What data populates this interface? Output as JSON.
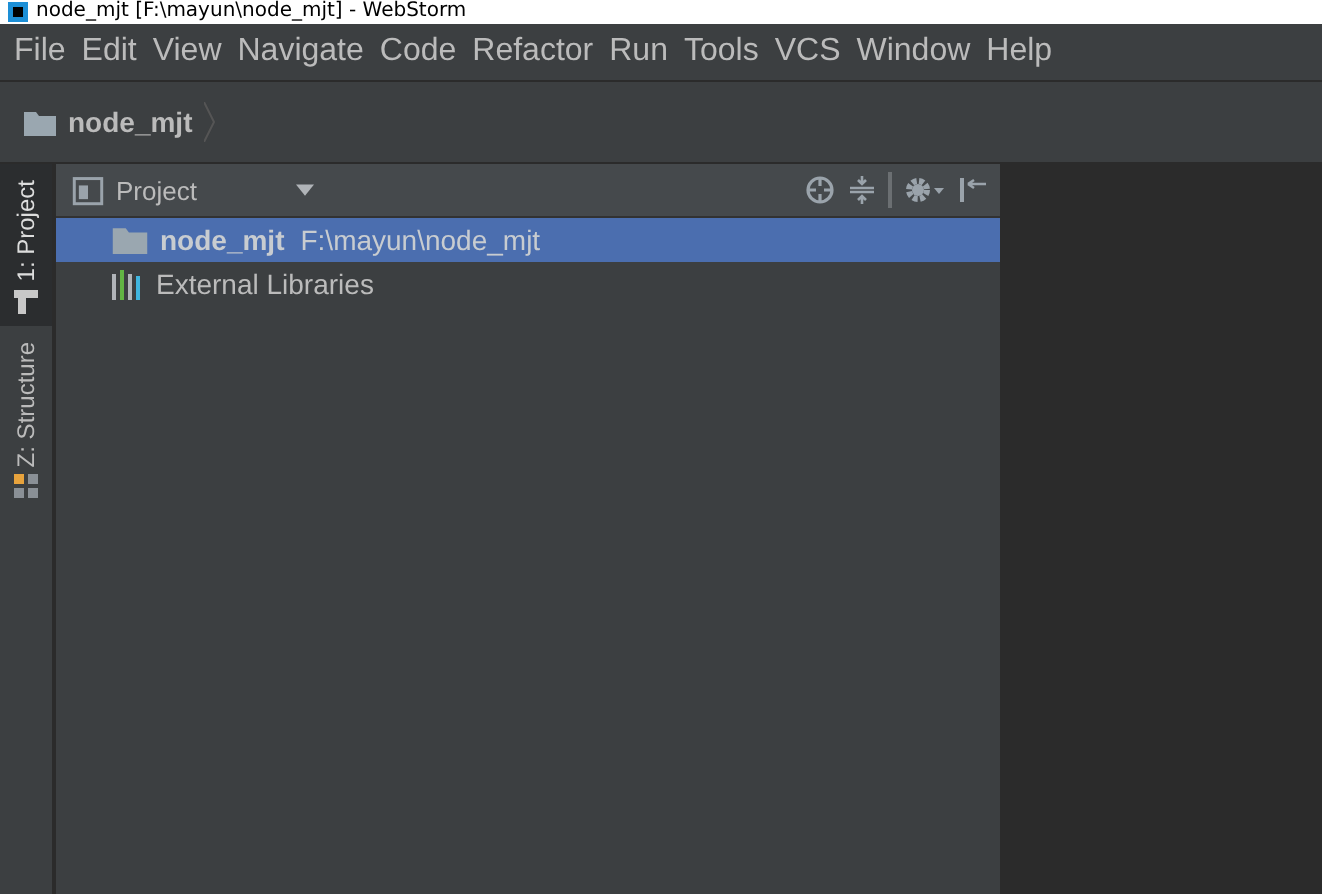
{
  "window": {
    "title": "node_mjt [F:\\mayun\\node_mjt] - WebStorm"
  },
  "menu": [
    "File",
    "Edit",
    "View",
    "Navigate",
    "Code",
    "Refactor",
    "Run",
    "Tools",
    "VCS",
    "Window",
    "Help"
  ],
  "breadcrumb": {
    "label": "node_mjt"
  },
  "side_tabs": [
    {
      "label": "1: Project",
      "selected": true
    },
    {
      "label": "Z: Structure",
      "selected": false
    }
  ],
  "project_panel": {
    "title": "Project",
    "items": [
      {
        "kind": "folder",
        "name": "node_mjt",
        "path": "F:\\mayun\\node_mjt",
        "selected": true
      },
      {
        "kind": "libraries",
        "name": "External Libraries",
        "selected": false
      }
    ]
  }
}
